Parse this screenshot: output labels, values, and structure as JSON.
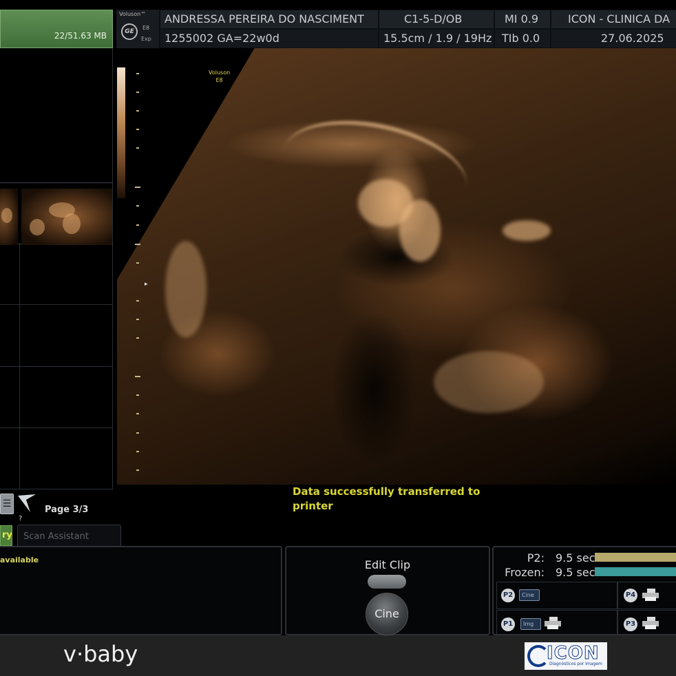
{
  "storage": {
    "usage": "22/51.63 MB"
  },
  "header": {
    "system": {
      "brand": "Voluson™",
      "model": "E8",
      "mode": "Exp",
      "logo": "GE"
    },
    "patient_name": "ANDRESSA PEREIRA DO NASCIMENT",
    "patient_id_ga": "1255002  GA=22w0d",
    "probe": "C1-5-D/OB",
    "depth_freq": "15.5cm / 1.9 / 19Hz",
    "mi": "MI  0.9",
    "tib": "TIb  0.0",
    "institution": "ICON - CLINICA DA",
    "date": "27.06.2025"
  },
  "image": {
    "overlay_brand": "Voluson",
    "overlay_model": "E8",
    "focus_marker": "▸"
  },
  "status": {
    "message": "Data successfully transferred to printer"
  },
  "pager": {
    "help": "?",
    "page": "Page 3/3",
    "list_icon": "☰"
  },
  "tabs": {
    "active_label": "ry",
    "scan_assistant": "Scan Assistant"
  },
  "left_panel": {
    "message": "available"
  },
  "cine": {
    "edit_clip": "Edit Clip",
    "cine": "Cine"
  },
  "clips": {
    "rows": [
      {
        "label": "P2:",
        "time": "9.5 sec",
        "color": "#b7a96b"
      },
      {
        "label": "Frozen:",
        "time": "9.5 sec",
        "color": "#3b9a9a"
      }
    ],
    "buttons": [
      {
        "id": "P2",
        "chip": "Cine"
      },
      {
        "id": "P4",
        "chip": ""
      },
      {
        "id": "P1",
        "chip": "Img"
      },
      {
        "id": "P3",
        "chip": ""
      }
    ]
  },
  "footer": {
    "brand": "v·baby",
    "partner_logo": "ICON",
    "partner_tagline": "Diagnósticos por Imagem"
  },
  "colors": {
    "accent_green": "#4e7f38",
    "status_yellow": "#d9d838",
    "ultrasound_sepia": "#8a5a32"
  }
}
